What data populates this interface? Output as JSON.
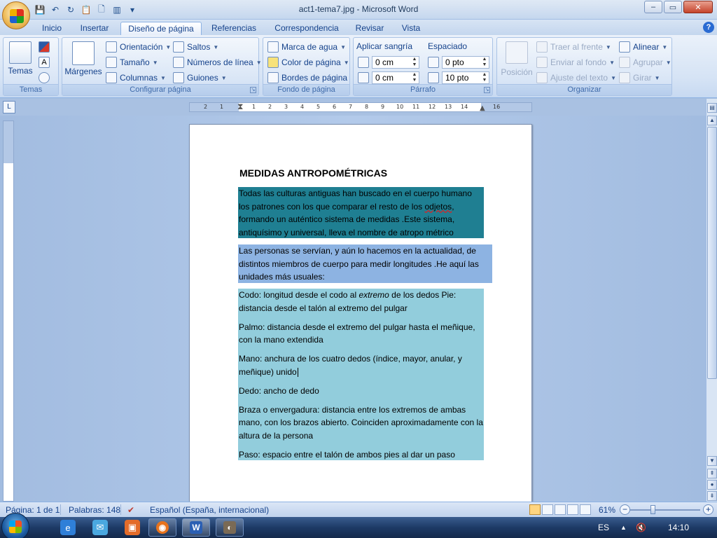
{
  "window": {
    "title": "act1-tema7.jpg - Microsoft Word",
    "minimize": "–",
    "maximize": "▭",
    "close": "✕"
  },
  "qat": [
    "save-icon",
    "undo-icon",
    "redo-icon",
    "paste-icon",
    "new-doc-icon",
    "columns-icon",
    "customize-icon"
  ],
  "tabs": [
    "Inicio",
    "Insertar",
    "Diseño de página",
    "Referencias",
    "Correspondencia",
    "Revisar",
    "Vista"
  ],
  "active_tab": "Diseño de página",
  "help": "?",
  "ribbon": {
    "temas": {
      "label": "Temas",
      "group": "Temas"
    },
    "configurar": {
      "group": "Configurar página",
      "margenes": "Márgenes",
      "orientacion": "Orientación",
      "tamano": "Tamaño",
      "columnas": "Columnas",
      "saltos": "Saltos",
      "numeros_linea": "Números de línea",
      "guiones": "Guiones"
    },
    "fondo": {
      "group": "Fondo de página",
      "marca_agua": "Marca de agua",
      "color_pagina": "Color de página",
      "bordes_pagina": "Bordes de página"
    },
    "parrafo": {
      "group": "Párrafo",
      "aplicar_sangria": "Aplicar sangría",
      "espaciado": "Espaciado",
      "sangria_izq": "0 cm",
      "sangria_der": "0 cm",
      "espaciado_antes": "0 pto",
      "espaciado_despues": "10 pto"
    },
    "organizar": {
      "group": "Organizar",
      "posicion": "Posición",
      "traer_frente": "Traer al frente",
      "enviar_fondo": "Enviar al fondo",
      "ajuste_texto": "Ajuste del texto",
      "alinear": "Alinear",
      "agrupar": "Agrupar",
      "girar": "Girar"
    }
  },
  "ruler": {
    "corner": "L",
    "ticks": [
      "2",
      "1",
      "1",
      "2",
      "3",
      "4",
      "5",
      "6",
      "7",
      "8",
      "9",
      "10",
      "11",
      "12",
      "13",
      "14",
      "15",
      "16"
    ]
  },
  "document": {
    "title": "MEDIDAS ANTROPOMÉTRICAS",
    "p1": {
      "before": "Todas las culturas antiguas han buscado en el cuerpo humano los patrones con los que comparar el resto de los ",
      "error_word": "odjetos",
      "after": ", formando un auténtico sistema de medidas .Este sistema, antiquísimo y universal, lleva el nombre de atropo métrico"
    },
    "p2": "Las personas se servían, y aún lo hacemos en la actualidad, de distintos miembros de cuerpo para medir longitudes .He aquí las unidades más usuales:",
    "items": [
      {
        "before": "Codo: longitud desde el codo al ",
        "italic": "extremo",
        "after": "  de los dedos Pie: distancia desde el talón al extremo del pulgar"
      },
      {
        "before": "Palmo: distancia desde el extremo del pulgar hasta el meñique, con la mano extendida",
        "italic": "",
        "after": ""
      },
      {
        "before": "Mano: anchura de los cuatro dedos (índice, mayor, anular, y meñique) unido",
        "italic": "",
        "after": ""
      },
      {
        "before": "Dedo: ancho de dedo",
        "italic": "",
        "after": ""
      },
      {
        "before": "Braza o envergadura: distancia entre los extremos de ambas mano, con los brazos abierto. Coinciden aproximadamente con la altura de la persona",
        "italic": "",
        "after": ""
      },
      {
        "before": "Paso: espacio entre el talón de ambos pies al dar un paso",
        "italic": "",
        "after": ""
      }
    ]
  },
  "status": {
    "pagina": "Página: 1 de 1",
    "palabras": "Palabras: 148",
    "idioma": "Español (España, internacional)",
    "zoom": "61%",
    "zoom_minus": "−",
    "zoom_plus": "+"
  },
  "taskbar": {
    "apps": [
      "ie-icon",
      "messenger-icon",
      "folder-icon",
      "firefox-icon",
      "word-icon",
      "gimp-icon"
    ],
    "lang": "ES",
    "time": "14:10"
  },
  "colors": {
    "para1_bg": "#1f7f92",
    "para2_bg": "#8db3e2",
    "para3_bg": "#92cddc"
  }
}
